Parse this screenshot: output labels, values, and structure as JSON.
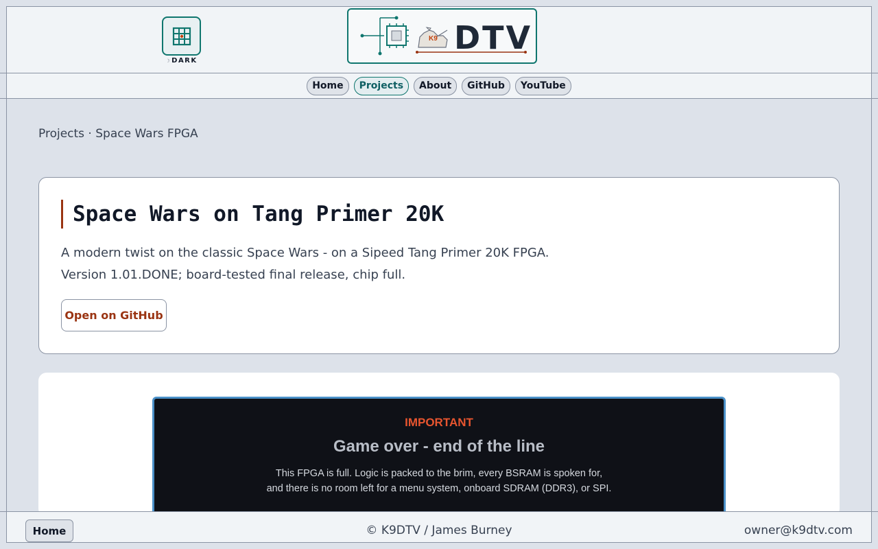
{
  "header": {
    "theme_toggle_label": "DARK",
    "logo_text": "DTV",
    "logo_badge": "K9"
  },
  "nav": {
    "items": [
      {
        "label": "Home",
        "active": false
      },
      {
        "label": "Projects",
        "active": true
      },
      {
        "label": "About",
        "active": false
      },
      {
        "label": "GitHub",
        "active": false
      },
      {
        "label": "YouTube",
        "active": false
      }
    ]
  },
  "breadcrumb": "Projects · Space Wars FPGA",
  "project": {
    "title": "Space Wars on Tang Primer 20K",
    "description_line1": "A modern twist on the classic Space Wars - on a Sipeed Tang Primer 20K FPGA.",
    "description_line2": "Version 1.01.DONE; board-tested final release, chip full.",
    "github_button": "Open on GitHub"
  },
  "notice": {
    "kicker": "IMPORTANT",
    "title": "Game over - end of the line",
    "body_line1": "This FPGA is full. Logic is packed to the brim, every BSRAM is spoken for,",
    "body_line2": "and there is no room left for a menu system, onboard SDRAM (DDR3), or SPI."
  },
  "footer": {
    "home_button": "Home",
    "copyright": "© K9DTV / James Burney",
    "email": "owner@k9dtv.com"
  },
  "colors": {
    "accent_teal": "#0f766e",
    "accent_rust": "#9a3412",
    "notice_kicker": "#e8552f",
    "notice_border": "#4a90c8"
  }
}
